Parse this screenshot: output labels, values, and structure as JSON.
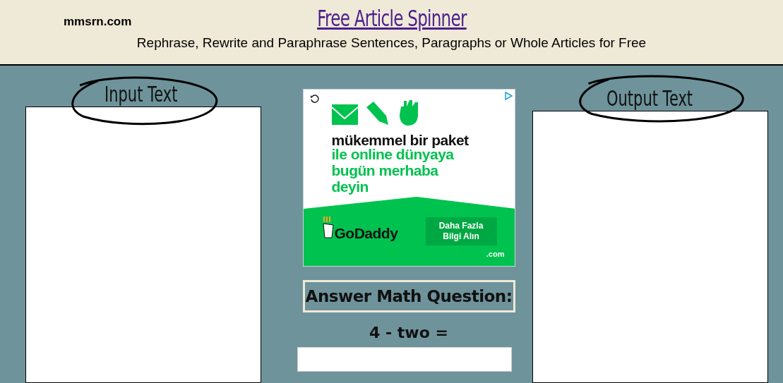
{
  "header": {
    "site": "mmsrn.com",
    "title": "Free Article Spinner",
    "subtitle": "Rephrase, Rewrite and Paraphrase Sentences, Paragraphs or Whole Articles for Free"
  },
  "input_panel": {
    "label": "Input Text"
  },
  "ad": {
    "headline": "mükemmel bir paket",
    "body": [
      "ile online dünyaya",
      "bugün merhaba",
      "deyin"
    ],
    "brand": "GoDaddy",
    "cta": [
      "Daha Fazla",
      "Bilgi Alın"
    ],
    "tld": ".com"
  },
  "math": {
    "heading": "Answer Math Question:",
    "question": "4 - two ="
  },
  "output_panel": {
    "label": "Output Text"
  }
}
